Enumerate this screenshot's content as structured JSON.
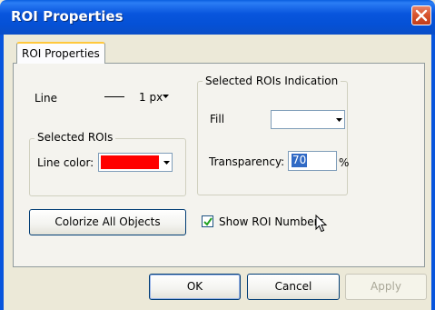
{
  "window": {
    "title": "ROI Properties"
  },
  "tabs": [
    {
      "label": "ROI Properties",
      "active": true
    }
  ],
  "line": {
    "label": "Line",
    "value": "1 px"
  },
  "selected_rois": {
    "group_title": "Selected ROIs",
    "line_color_label": "Line color:",
    "line_color": "#ff0000"
  },
  "indication": {
    "group_title": "Selected ROIs Indication",
    "fill_label": "Fill",
    "fill_color": "#ffffff",
    "transparency_label": "Transparency:",
    "transparency_value": "70",
    "transparency_unit": "%"
  },
  "actions": {
    "colorize_label": "Colorize All Objects",
    "show_numbers_label": "Show ROI Numbers",
    "show_numbers_checked": true
  },
  "footer": {
    "ok_label": "OK",
    "cancel_label": "Cancel",
    "apply_label": "Apply"
  },
  "icons": {
    "close": "close-icon",
    "dropdown": "chevron-down-icon",
    "check": "check-icon",
    "cursor": "mouse-pointer-icon"
  }
}
